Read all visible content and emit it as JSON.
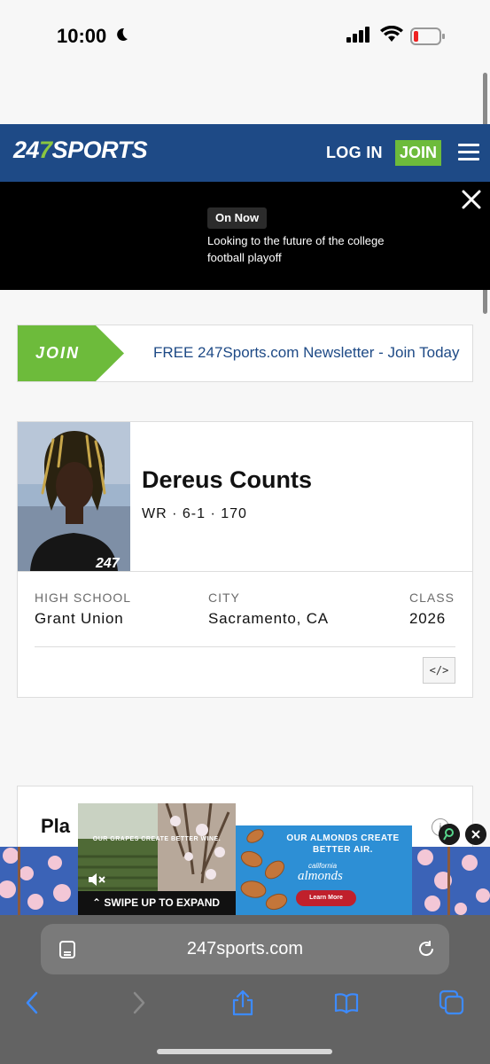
{
  "status_bar": {
    "time": "10:00"
  },
  "header": {
    "logo_digits": "24",
    "logo_seven": "7",
    "logo_word": "SPORTS",
    "login_label": "LOG IN",
    "join_label": "JOIN"
  },
  "on_now": {
    "badge": "On Now",
    "headline": "Looking to the future of the college football playoff"
  },
  "newsletter": {
    "join_label": "JOIN",
    "text": "FREE 247Sports.com Newsletter - Join Today"
  },
  "player": {
    "name": "Dereus Counts",
    "meta": "WR · 6-1 · 170",
    "photo_watermark": "247",
    "high_school_label": "HIGH SCHOOL",
    "high_school": "Grant Union",
    "city_label": "CITY",
    "city": "Sacramento, CA",
    "class_label": "CLASS",
    "class_year": "2026",
    "embed_label": "</>"
  },
  "next_section": {
    "title_partial": "Pla"
  },
  "ad": {
    "video_tagline": "OUR GRAPES CREATE BETTER WINE.",
    "swipe_label": "SWIPE UP TO EXPAND",
    "banner_headline": "OUR ALMONDS CREATE BETTER AIR.",
    "banner_brand_small": "california",
    "banner_brand": "almonds",
    "banner_cta": "Learn More",
    "info_label": "i"
  },
  "browser": {
    "url": "247sports.com"
  },
  "colors": {
    "brand_blue": "#1e4a86",
    "brand_green": "#6dbb3b",
    "link_blue": "#1e4a86"
  }
}
